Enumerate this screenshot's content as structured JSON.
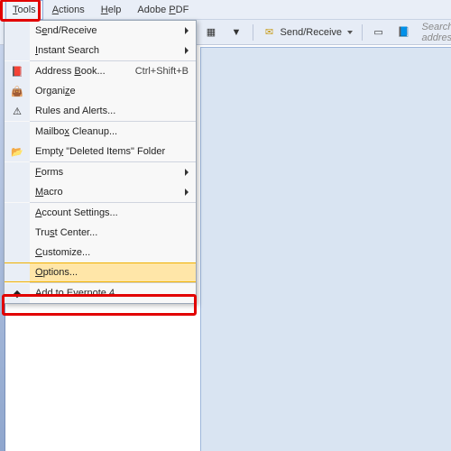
{
  "menubar": {
    "items": [
      {
        "label": "Tools",
        "accesskey": "T",
        "active": true
      },
      {
        "label": "Actions",
        "accesskey": "A"
      },
      {
        "label": "Help",
        "accesskey": "H"
      },
      {
        "label": "Adobe PDF",
        "accesskey": "P"
      }
    ]
  },
  "dropdown": {
    "items": [
      {
        "label": "Send/Receive",
        "accesskey": "e",
        "submenu": true
      },
      {
        "label": "Instant Search",
        "accesskey": "I",
        "submenu": true
      },
      {
        "sep": true
      },
      {
        "label": "Address Book...",
        "accesskey": "B",
        "icon": "book-icon",
        "shortcut": "Ctrl+Shift+B"
      },
      {
        "label": "Organize",
        "accesskey": "z",
        "icon": "bag-icon"
      },
      {
        "label": "Rules and Alerts...",
        "accesskey": "L",
        "icon": "bell-icon"
      },
      {
        "sep": true
      },
      {
        "label": "Mailbox Cleanup...",
        "accesskey": "x"
      },
      {
        "label": "Empty \"Deleted Items\" Folder",
        "accesskey": "y",
        "icon": "folder-icon"
      },
      {
        "sep": true
      },
      {
        "label": "Forms",
        "accesskey": "F",
        "submenu": true
      },
      {
        "label": "Macro",
        "accesskey": "M",
        "submenu": true
      },
      {
        "sep": true
      },
      {
        "label": "Account Settings...",
        "accesskey": "A"
      },
      {
        "label": "Trust Center...",
        "accesskey": "s"
      },
      {
        "label": "Customize...",
        "accesskey": "C"
      },
      {
        "label": "Options...",
        "accesskey": "O",
        "highlight": true
      },
      {
        "sep": true
      },
      {
        "label": "Add to Evernote 4",
        "icon": "evernote-icon"
      }
    ]
  },
  "toolbar": {
    "send_receive_label": "Send/Receive",
    "search_placeholder": "Search address"
  },
  "icons": {
    "book-icon": "📕",
    "bag-icon": "👜",
    "bell-icon": "⚠",
    "folder-icon": "📂",
    "evernote-icon": "◆",
    "envelope-icon": "✉",
    "bluebook-icon": "📘"
  }
}
